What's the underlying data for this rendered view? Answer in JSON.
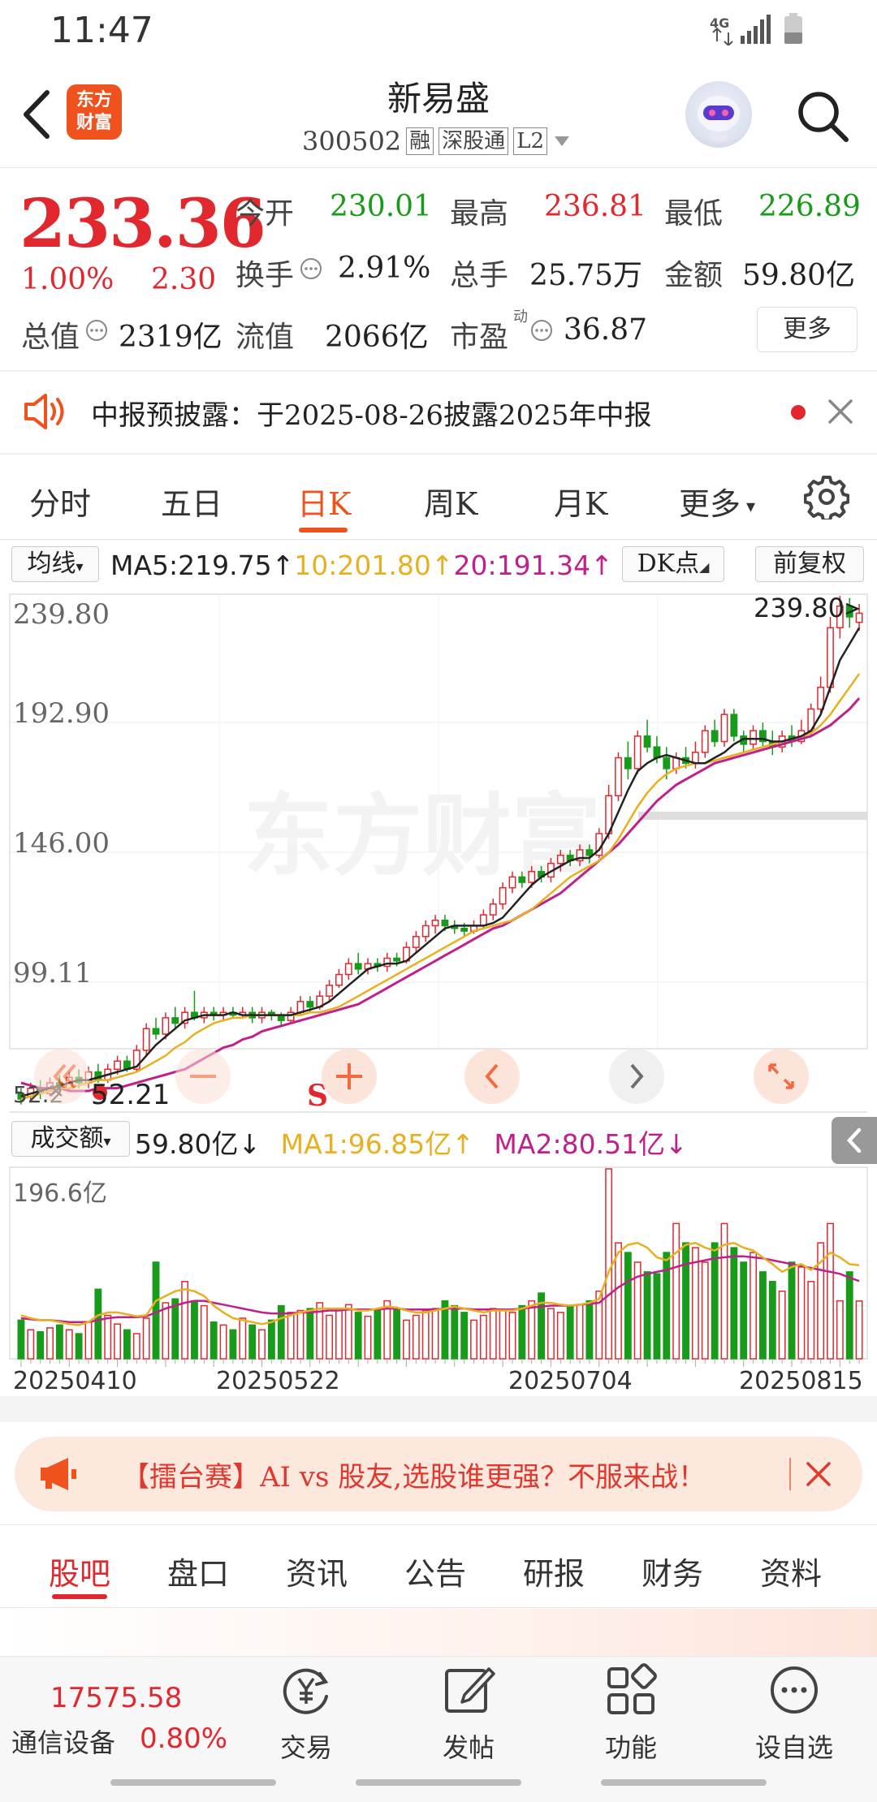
{
  "status_bar": {
    "time": "11:47",
    "network": "4G"
  },
  "header": {
    "stock_name": "新易盛",
    "stock_code": "300502",
    "tags": [
      "融",
      "深股通",
      "L2"
    ],
    "logo_text": [
      "东方",
      "财富"
    ]
  },
  "quote": {
    "price": "233.36",
    "change_pct": "1.00%",
    "change_amt": "2.30",
    "fields": {
      "open_label": "今开",
      "open": "230.01",
      "high_label": "最高",
      "high": "236.81",
      "low_label": "最低",
      "low": "226.89",
      "turnover_label": "换手",
      "turnover": "2.91%",
      "volume_label": "总手",
      "volume": "25.75万",
      "amount_label": "金额",
      "amount": "59.80亿",
      "mktcap_label": "总值",
      "mktcap": "2319亿",
      "float_label": "流值",
      "float": "2066亿",
      "pe_label": "市盈",
      "pe_sup": "动",
      "pe": "36.87"
    },
    "more_label": "更多"
  },
  "notice": {
    "text": "中报预披露：于2025-08-26披露2025年中报"
  },
  "period_tabs": [
    "分时",
    "五日",
    "日K",
    "周K",
    "月K",
    "更多"
  ],
  "active_period": "日K",
  "ma_row": {
    "selector": "均线",
    "ma5": "MA5:219.75↑",
    "ma10": "10:201.80↑",
    "ma20": "20:191.34↑",
    "dk_label": "DK点",
    "adjust_label": "前复权"
  },
  "price_axis": [
    "239.80",
    "192.90",
    "146.00",
    "99.11"
  ],
  "price_annotations": {
    "high": "239.80",
    "low_marker": "52.21",
    "low_left": "52.2"
  },
  "watermark": "东方财富",
  "signal_label": "S",
  "volume_row": {
    "selector": "成交额",
    "value": "59.80亿↓",
    "ma1": "MA1:96.85亿↑",
    "ma2": "MA2:80.51亿↓"
  },
  "volume_axis": "196.6亿",
  "dates": [
    "20250410",
    "20250522",
    "20250704",
    "20250815"
  ],
  "banner": {
    "text": "【擂台赛】AI vs 股友,选股谁更强？不服来战！"
  },
  "bottom_tabs": [
    "股吧",
    "盘口",
    "资讯",
    "公告",
    "研报",
    "财务",
    "资料"
  ],
  "active_bottom_tab": "股吧",
  "bottom_nav": {
    "index_value": "17575.58",
    "index_name": "通信设备",
    "index_pct": "0.80%",
    "items": [
      "交易",
      "发帖",
      "功能",
      "设自选"
    ]
  },
  "colors": {
    "up": "#e0282e",
    "down": "#189a1a",
    "accent": "#f0521e",
    "ma5": "#222222",
    "ma10": "#e8b020",
    "ma20": "#c0208a"
  },
  "chart_data": {
    "type": "candlestick",
    "price_range": [
      52.2,
      239.8
    ],
    "candles": [
      {
        "o": 56,
        "c": 54,
        "h": 58,
        "l": 52
      },
      {
        "o": 55,
        "c": 58,
        "h": 60,
        "l": 53
      },
      {
        "o": 58,
        "c": 56,
        "h": 61,
        "l": 54
      },
      {
        "o": 56,
        "c": 60,
        "h": 62,
        "l": 55
      },
      {
        "o": 60,
        "c": 58,
        "h": 63,
        "l": 56
      },
      {
        "o": 58,
        "c": 62,
        "h": 64,
        "l": 57
      },
      {
        "o": 62,
        "c": 60,
        "h": 65,
        "l": 58
      },
      {
        "o": 60,
        "c": 64,
        "h": 66,
        "l": 58
      },
      {
        "o": 64,
        "c": 61,
        "h": 67,
        "l": 60
      },
      {
        "o": 61,
        "c": 65,
        "h": 67,
        "l": 60
      },
      {
        "o": 65,
        "c": 68,
        "h": 70,
        "l": 63
      },
      {
        "o": 68,
        "c": 65,
        "h": 70,
        "l": 64
      },
      {
        "o": 65,
        "c": 72,
        "h": 74,
        "l": 64
      },
      {
        "o": 72,
        "c": 80,
        "h": 82,
        "l": 70
      },
      {
        "o": 80,
        "c": 78,
        "h": 84,
        "l": 76
      },
      {
        "o": 78,
        "c": 84,
        "h": 86,
        "l": 76
      },
      {
        "o": 84,
        "c": 82,
        "h": 88,
        "l": 80
      },
      {
        "o": 82,
        "c": 86,
        "h": 88,
        "l": 80
      },
      {
        "o": 86,
        "c": 84,
        "h": 94,
        "l": 83
      },
      {
        "o": 84,
        "c": 86,
        "h": 88,
        "l": 82
      },
      {
        "o": 86,
        "c": 85,
        "h": 88,
        "l": 83
      },
      {
        "o": 85,
        "c": 86,
        "h": 88,
        "l": 83
      },
      {
        "o": 86,
        "c": 85,
        "h": 88,
        "l": 84
      },
      {
        "o": 85,
        "c": 86,
        "h": 88,
        "l": 84
      },
      {
        "o": 86,
        "c": 84,
        "h": 88,
        "l": 82
      },
      {
        "o": 84,
        "c": 86,
        "h": 88,
        "l": 82
      },
      {
        "o": 86,
        "c": 85,
        "h": 87,
        "l": 83
      },
      {
        "o": 85,
        "c": 83,
        "h": 86,
        "l": 81
      },
      {
        "o": 83,
        "c": 86,
        "h": 88,
        "l": 82
      },
      {
        "o": 86,
        "c": 90,
        "h": 92,
        "l": 85
      },
      {
        "o": 90,
        "c": 88,
        "h": 92,
        "l": 86
      },
      {
        "o": 88,
        "c": 92,
        "h": 94,
        "l": 87
      },
      {
        "o": 92,
        "c": 96,
        "h": 98,
        "l": 90
      },
      {
        "o": 96,
        "c": 100,
        "h": 102,
        "l": 95
      },
      {
        "o": 100,
        "c": 104,
        "h": 106,
        "l": 98
      },
      {
        "o": 104,
        "c": 102,
        "h": 108,
        "l": 100
      },
      {
        "o": 102,
        "c": 104,
        "h": 106,
        "l": 100
      },
      {
        "o": 104,
        "c": 103,
        "h": 106,
        "l": 101
      },
      {
        "o": 103,
        "c": 106,
        "h": 108,
        "l": 101
      },
      {
        "o": 106,
        "c": 105,
        "h": 108,
        "l": 103
      },
      {
        "o": 105,
        "c": 110,
        "h": 112,
        "l": 104
      },
      {
        "o": 110,
        "c": 114,
        "h": 116,
        "l": 108
      },
      {
        "o": 114,
        "c": 118,
        "h": 120,
        "l": 112
      },
      {
        "o": 118,
        "c": 120,
        "h": 122,
        "l": 115
      },
      {
        "o": 120,
        "c": 118,
        "h": 122,
        "l": 116
      },
      {
        "o": 118,
        "c": 117,
        "h": 120,
        "l": 115
      },
      {
        "o": 117,
        "c": 116,
        "h": 119,
        "l": 114
      },
      {
        "o": 116,
        "c": 118,
        "h": 120,
        "l": 115
      },
      {
        "o": 118,
        "c": 122,
        "h": 124,
        "l": 117
      },
      {
        "o": 122,
        "c": 126,
        "h": 128,
        "l": 120
      },
      {
        "o": 126,
        "c": 132,
        "h": 134,
        "l": 124
      },
      {
        "o": 132,
        "c": 136,
        "h": 138,
        "l": 130
      },
      {
        "o": 136,
        "c": 134,
        "h": 138,
        "l": 132
      },
      {
        "o": 134,
        "c": 138,
        "h": 140,
        "l": 132
      },
      {
        "o": 138,
        "c": 136,
        "h": 140,
        "l": 134
      },
      {
        "o": 136,
        "c": 141,
        "h": 143,
        "l": 134
      },
      {
        "o": 141,
        "c": 144,
        "h": 146,
        "l": 138
      },
      {
        "o": 144,
        "c": 142,
        "h": 146,
        "l": 140
      },
      {
        "o": 142,
        "c": 146,
        "h": 148,
        "l": 140
      },
      {
        "o": 146,
        "c": 144,
        "h": 148,
        "l": 141
      },
      {
        "o": 144,
        "c": 152,
        "h": 154,
        "l": 143
      },
      {
        "o": 152,
        "c": 166,
        "h": 170,
        "l": 150
      },
      {
        "o": 166,
        "c": 180,
        "h": 182,
        "l": 164
      },
      {
        "o": 180,
        "c": 176,
        "h": 186,
        "l": 172
      },
      {
        "o": 176,
        "c": 188,
        "h": 190,
        "l": 174
      },
      {
        "o": 188,
        "c": 184,
        "h": 194,
        "l": 182
      },
      {
        "o": 184,
        "c": 180,
        "h": 188,
        "l": 178
      },
      {
        "o": 180,
        "c": 176,
        "h": 184,
        "l": 172
      },
      {
        "o": 176,
        "c": 180,
        "h": 182,
        "l": 174
      },
      {
        "o": 180,
        "c": 178,
        "h": 184,
        "l": 176
      },
      {
        "o": 178,
        "c": 182,
        "h": 186,
        "l": 176
      },
      {
        "o": 182,
        "c": 190,
        "h": 192,
        "l": 180
      },
      {
        "o": 190,
        "c": 186,
        "h": 194,
        "l": 184
      },
      {
        "o": 186,
        "c": 196,
        "h": 198,
        "l": 184
      },
      {
        "o": 196,
        "c": 188,
        "h": 198,
        "l": 186
      },
      {
        "o": 188,
        "c": 185,
        "h": 190,
        "l": 182
      },
      {
        "o": 185,
        "c": 190,
        "h": 192,
        "l": 183
      },
      {
        "o": 190,
        "c": 186,
        "h": 193,
        "l": 184
      },
      {
        "o": 186,
        "c": 184,
        "h": 190,
        "l": 181
      },
      {
        "o": 184,
        "c": 188,
        "h": 190,
        "l": 182
      },
      {
        "o": 188,
        "c": 186,
        "h": 192,
        "l": 184
      },
      {
        "o": 186,
        "c": 190,
        "h": 194,
        "l": 185
      },
      {
        "o": 190,
        "c": 198,
        "h": 200,
        "l": 188
      },
      {
        "o": 198,
        "c": 206,
        "h": 210,
        "l": 196
      },
      {
        "o": 206,
        "c": 228,
        "h": 232,
        "l": 204
      },
      {
        "o": 228,
        "c": 236,
        "h": 239.8,
        "l": 224
      },
      {
        "o": 236,
        "c": 232,
        "h": 239,
        "l": 228
      },
      {
        "o": 230.01,
        "c": 233.36,
        "h": 236.81,
        "l": 226.89
      }
    ],
    "ma5": [
      55,
      56,
      57,
      58,
      59,
      60,
      61,
      61,
      62,
      63,
      64,
      65,
      66,
      70,
      74,
      77,
      80,
      83,
      84,
      85,
      85,
      85,
      86,
      85,
      85,
      85,
      85,
      85,
      85,
      86,
      87,
      88,
      90,
      93,
      96,
      99,
      102,
      103,
      104,
      104,
      105,
      108,
      111,
      114,
      117,
      118,
      118,
      118,
      118,
      119,
      121,
      125,
      129,
      133,
      136,
      138,
      140,
      142,
      143,
      143,
      146,
      152,
      160,
      168,
      175,
      178,
      180,
      181,
      180,
      179,
      178,
      178,
      180,
      182,
      185,
      187,
      187,
      187,
      186,
      186,
      187,
      188,
      190,
      196,
      206,
      216,
      222,
      228
    ],
    "ma10": [
      54,
      55,
      56,
      57,
      58,
      58,
      59,
      60,
      61,
      61,
      62,
      63,
      64,
      66,
      68,
      70,
      73,
      75,
      78,
      80,
      82,
      83,
      84,
      84,
      85,
      85,
      85,
      85,
      85,
      85,
      86,
      86,
      87,
      88,
      90,
      92,
      94,
      96,
      98,
      100,
      102,
      104,
      106,
      108,
      110,
      112,
      114,
      116,
      117,
      118,
      119,
      120,
      122,
      124,
      127,
      130,
      133,
      136,
      138,
      140,
      142,
      145,
      150,
      156,
      162,
      167,
      171,
      174,
      176,
      177,
      178,
      178,
      179,
      180,
      181,
      182,
      183,
      184,
      185,
      186,
      187,
      188,
      189,
      192,
      196,
      201,
      206,
      211
    ],
    "ma20": [
      60,
      59,
      58,
      58,
      58,
      57,
      57,
      57,
      58,
      58,
      58,
      59,
      60,
      61,
      62,
      63,
      64,
      65,
      67,
      69,
      71,
      73,
      74,
      76,
      77,
      79,
      80,
      81,
      82,
      83,
      84,
      85,
      86,
      87,
      88,
      89,
      91,
      93,
      95,
      97,
      99,
      101,
      103,
      105,
      107,
      109,
      111,
      113,
      115,
      117,
      118,
      120,
      122,
      124,
      126,
      128,
      130,
      133,
      136,
      139,
      142,
      145,
      148,
      152,
      156,
      160,
      164,
      167,
      170,
      172,
      174,
      176,
      178,
      179,
      180,
      181,
      182,
      183,
      184,
      185,
      186,
      187,
      188,
      190,
      192,
      195,
      198,
      202
    ],
    "volume_range": [
      0,
      196.6
    ],
    "volumes": [
      40,
      30,
      28,
      32,
      35,
      30,
      26,
      38,
      72,
      45,
      36,
      30,
      26,
      42,
      100,
      58,
      62,
      80,
      60,
      55,
      38,
      35,
      30,
      42,
      35,
      30,
      40,
      55,
      48,
      50,
      52,
      58,
      45,
      52,
      56,
      48,
      44,
      50,
      60,
      52,
      40,
      45,
      50,
      52,
      60,
      55,
      48,
      40,
      45,
      52,
      50,
      48,
      55,
      60,
      68,
      52,
      48,
      55,
      56,
      60,
      70,
      196.6,
      120,
      110,
      100,
      90,
      88,
      110,
      140,
      120,
      115,
      100,
      120,
      140,
      115,
      100,
      110,
      90,
      80,
      70,
      100,
      95,
      80,
      120,
      140,
      60,
      90,
      59.8
    ],
    "volume_ma1": [
      45,
      42,
      40,
      40,
      38,
      36,
      35,
      38,
      45,
      48,
      48,
      46,
      44,
      45,
      60,
      65,
      70,
      72,
      70,
      65,
      55,
      48,
      42,
      40,
      38,
      36,
      38,
      42,
      45,
      48,
      50,
      52,
      52,
      52,
      52,
      50,
      50,
      52,
      54,
      53,
      50,
      48,
      48,
      50,
      52,
      54,
      52,
      50,
      48,
      50,
      50,
      50,
      52,
      55,
      58,
      58,
      56,
      55,
      56,
      58,
      62,
      90,
      110,
      118,
      120,
      115,
      105,
      102,
      110,
      118,
      120,
      115,
      112,
      118,
      120,
      115,
      112,
      105,
      98,
      90,
      95,
      98,
      92,
      100,
      110,
      105,
      98,
      96.85
    ],
    "volume_ma2": [
      42,
      41,
      40,
      40,
      39,
      38,
      38,
      38,
      40,
      42,
      43,
      43,
      43,
      44,
      48,
      52,
      55,
      58,
      60,
      60,
      58,
      56,
      54,
      52,
      50,
      48,
      47,
      47,
      47,
      48,
      48,
      49,
      50,
      50,
      51,
      51,
      51,
      51,
      52,
      52,
      51,
      51,
      51,
      51,
      52,
      52,
      52,
      51,
      51,
      51,
      51,
      51,
      52,
      53,
      54,
      55,
      55,
      55,
      56,
      57,
      58,
      66,
      74,
      80,
      85,
      88,
      90,
      92,
      95,
      98,
      100,
      102,
      104,
      105,
      106,
      106,
      105,
      104,
      102,
      100,
      98,
      96,
      94,
      92,
      90,
      88,
      84,
      80.51
    ]
  }
}
